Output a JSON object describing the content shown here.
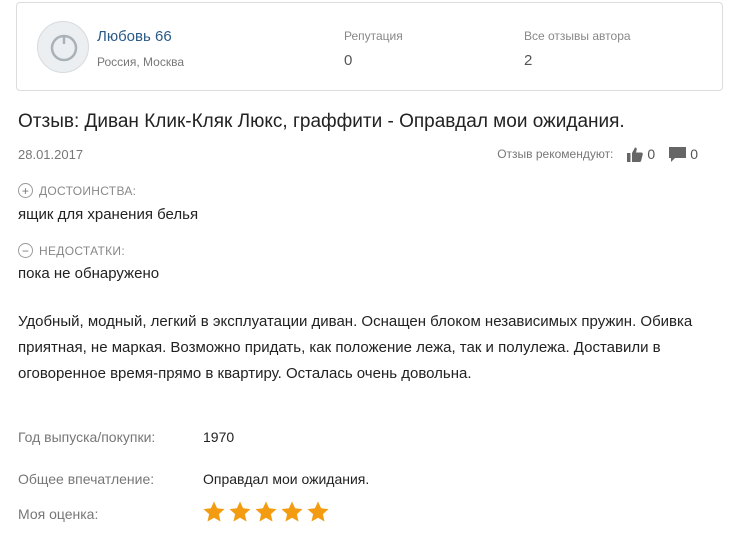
{
  "author": {
    "name": "Любовь 66",
    "location": "Россия, Москва",
    "reputation_label": "Репутация",
    "reputation_value": "0",
    "all_reviews_label": "Все отзывы автора",
    "all_reviews_value": "2"
  },
  "review": {
    "title": "Отзыв: Диван Клик-Кляк Люкс, граффити - Оправдал мои ожидания.",
    "date": "28.01.2017",
    "recommend_label": "Отзыв рекомендуют:",
    "likes": "0",
    "comments": "0",
    "pros_label": "ДОСТОИНСТВА:",
    "pros_text": "ящик для хранения белья",
    "cons_label": "НЕДОСТАТКИ:",
    "cons_text": "пока не обнаружено",
    "body": "Удобный, модный, легкий в эксплуатации диван. Оснащен блоком независимых пружин. Обивка приятная, не маркая. Возможно придать, как положение лежа, так и полулежа. Доставили в оговоренное время-прямо в квартиру. Осталась очень довольна.",
    "year_label": "Год выпуска/покупки:",
    "year_value": "1970",
    "impression_label": "Общее впечатление:",
    "impression_value": "Оправдал мои ожидания.",
    "rating_label": "Моя оценка:",
    "rating": 5,
    "rating_max": 5
  },
  "icons": {
    "avatar": "user-avatar-icon",
    "like": "thumbs-up-icon",
    "comment": "comment-icon",
    "pros": "plus-circle-icon",
    "cons": "minus-circle-icon",
    "star": "star-icon"
  },
  "colors": {
    "author_link": "#2a5a87",
    "star": "#f39c12",
    "muted": "#777777"
  }
}
